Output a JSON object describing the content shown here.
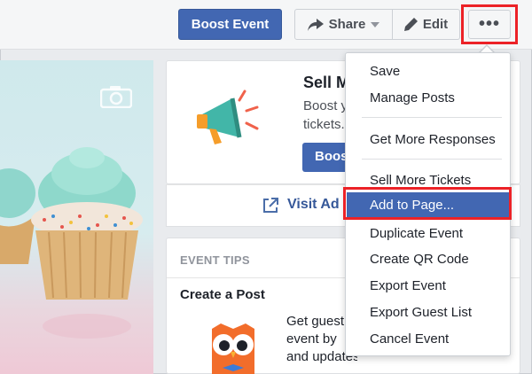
{
  "toolbar": {
    "boost_label": "Boost Event",
    "share_label": "Share",
    "edit_label": "Edit",
    "more_label": "•••"
  },
  "sell_card": {
    "title": "Sell M",
    "text_line1": "Boost y",
    "text_line2": "tickets.",
    "button_label": "Boos",
    "visit_label": "Visit Ad"
  },
  "event_tips": {
    "header": "EVENT TIPS",
    "title": "Create a Post",
    "text_line1": "Get guest",
    "text_line2": "event by",
    "text_line3": "and updates."
  },
  "menu": {
    "items": [
      {
        "label": "Save"
      },
      {
        "label": "Manage Posts"
      },
      {
        "label": "Get More Responses"
      },
      {
        "label": "Sell More Tickets"
      },
      {
        "label": "Add to Page..."
      },
      {
        "label": "Duplicate Event"
      },
      {
        "label": "Create QR Code"
      },
      {
        "label": "Export Event"
      },
      {
        "label": "Export Guest List"
      },
      {
        "label": "Cancel Event"
      }
    ],
    "active_item": "Add to Page..."
  },
  "colors": {
    "brand_blue": "#4267b2",
    "highlight_red": "#ec2227",
    "link_blue": "#365899"
  },
  "icons": [
    "camera-icon",
    "megaphone-icon",
    "share-arrow-icon",
    "pencil-icon",
    "external-link-icon",
    "owl-icon"
  ]
}
